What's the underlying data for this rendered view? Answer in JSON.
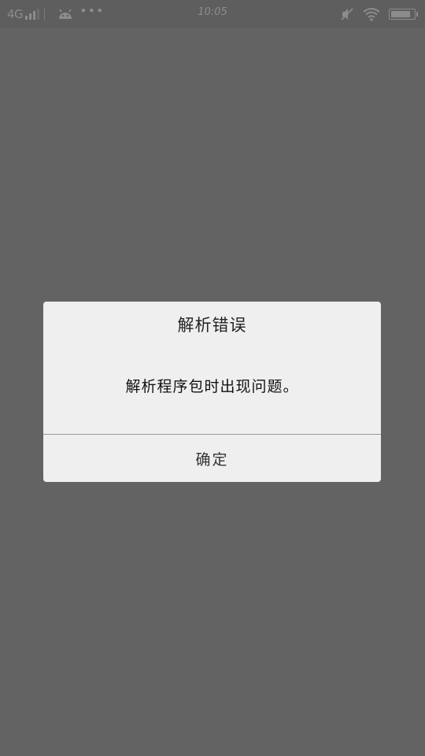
{
  "status_bar": {
    "network_label": "4G",
    "time": "10:05",
    "battery_level": 0.9,
    "signal_bars": 3,
    "icons": [
      "signal-icon",
      "android-icon",
      "more-dots-icon",
      "mute-icon",
      "wifi-icon",
      "battery-icon"
    ]
  },
  "dialog": {
    "title": "解析错误",
    "message": "解析程序包时出现问题。",
    "confirm_label": "确定"
  },
  "colors": {
    "overlay": "#636363",
    "dialog_bg": "#efefef",
    "divider": "#9a9a9a"
  }
}
